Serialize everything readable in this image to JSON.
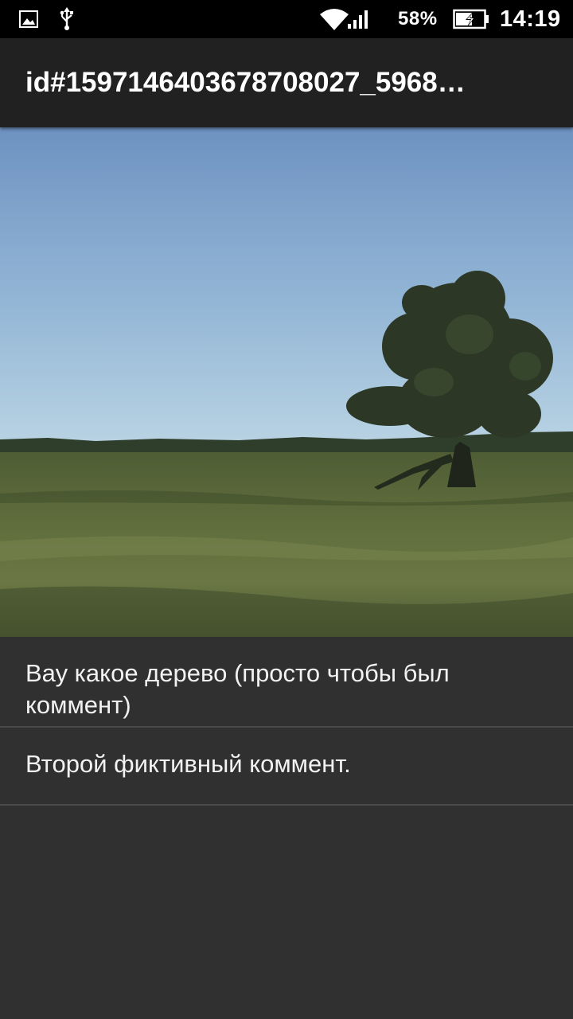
{
  "status_bar": {
    "icons": {
      "left": [
        "gallery-icon",
        "usb-icon"
      ],
      "right": [
        "wifi-icon",
        "signal-icon",
        "battery-charging-icon"
      ]
    },
    "battery_percent": "58%",
    "time": "14:19"
  },
  "app_bar": {
    "title": "id#1597146403678708027_5968…"
  },
  "photo": {
    "subject": "landscape-photo",
    "colors": {
      "sky_top": "#6f94c3",
      "sky_bottom": "#b6d0e1",
      "field": "#5b6a3d",
      "tree": "#2b3524"
    }
  },
  "comments": [
    {
      "text": "Вау какое дерево (просто чтобы был коммент)"
    },
    {
      "text": "Второй фиктивный коммент."
    }
  ],
  "theme": {
    "background": "#303030",
    "app_bar": "#212121",
    "status_bar": "#000000",
    "divider": "#4a4a4a",
    "text": "#f2f2f2"
  }
}
